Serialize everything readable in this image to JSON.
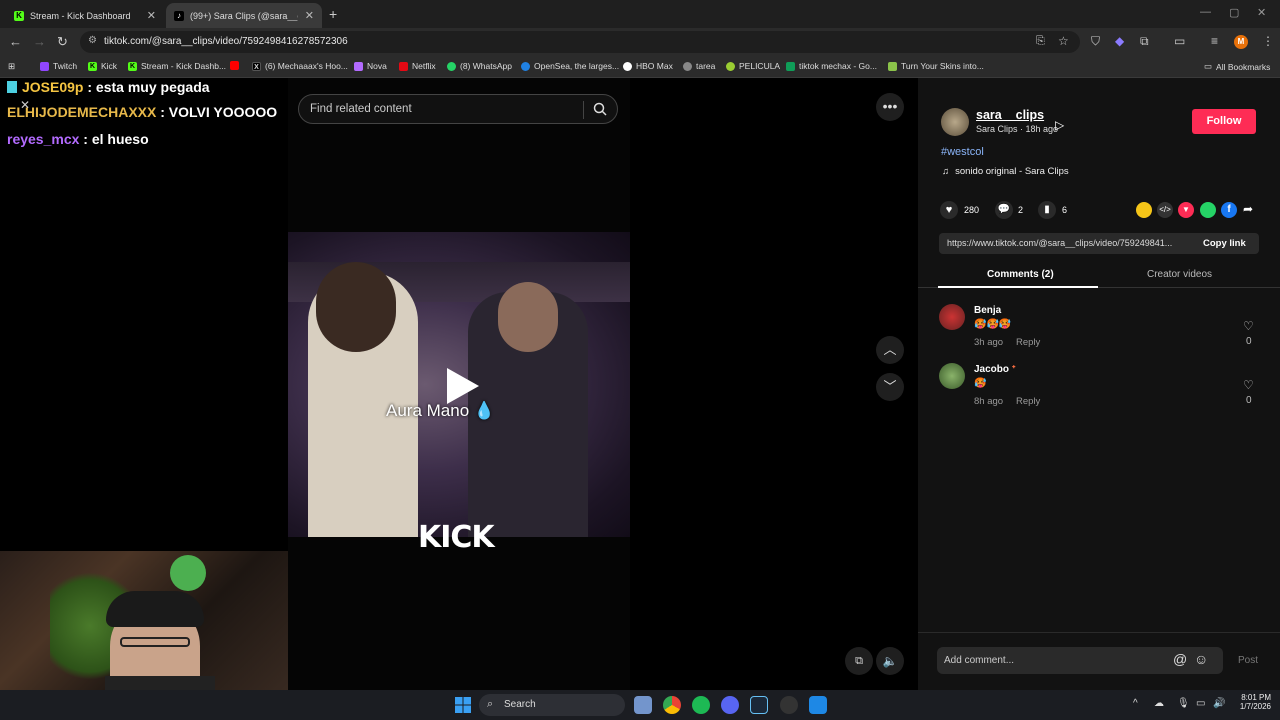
{
  "browser": {
    "tabs": [
      {
        "title": "Stream - Kick Dashboard",
        "active": false
      },
      {
        "title": "(99+) Sara Clips (@sara__clips) |",
        "active": true
      }
    ],
    "new_tab": "+",
    "url": "tiktok.com/@sara__clips/video/7592498416278572306",
    "bookmarks": [
      "Twitch",
      "Kick",
      "Stream - Kick Dashb...",
      "(6) Mechaaax's Hoo...",
      "Nova",
      "Netflix",
      "(8) WhatsApp",
      "OpenSea, the larges...",
      "HBO Max",
      "tarea",
      "PELICULA",
      "tiktok mechax - Go...",
      "Turn Your Skins into..."
    ],
    "all_bookmarks": "All Bookmarks",
    "profile_initial": "M"
  },
  "chat": {
    "lines": [
      {
        "user": "JOSE09p",
        "message": " : esta muy pegada",
        "color": "#f5c542"
      },
      {
        "user": "ELHIJODEMECHAXXX",
        "message": " : VOLVI YOOOOO",
        "color": "#e8b94a"
      },
      {
        "user": "reyes_mcx",
        "message": " : el hueso",
        "color": "#b36bff"
      }
    ]
  },
  "video": {
    "search_placeholder": "Find related content",
    "caption": "Aura Mano",
    "watermark": "KICK"
  },
  "creator": {
    "username": "sara__clips",
    "subline": "Sara Clips · 18h ago",
    "follow_label": "Follow",
    "hashtag": "#westcol",
    "sound": "sonido original - Sara Clips"
  },
  "stats": {
    "likes": "280",
    "comments": "2",
    "saves": "6"
  },
  "share": {
    "link": "https://www.tiktok.com/@sara__clips/video/759249841...",
    "copy_label": "Copy link"
  },
  "tabs": {
    "comments": "Comments (2)",
    "creator_videos": "Creator videos"
  },
  "comments": [
    {
      "name": "Benja",
      "emoji": "🥵🥵🥵",
      "time": "3h ago",
      "reply": "Reply",
      "likes": "0"
    },
    {
      "name": "Jacobo",
      "emoji": "🥵",
      "time": "8h ago",
      "reply": "Reply",
      "likes": "0"
    }
  ],
  "comment_box": {
    "placeholder": "Add comment...",
    "post_label": "Post"
  },
  "taskbar": {
    "search_label": "Search",
    "time": "8:01 PM",
    "date": "1/7/2026"
  },
  "colors": {
    "follow": "#fe2c55",
    "hashtag": "#8ab4f8"
  }
}
